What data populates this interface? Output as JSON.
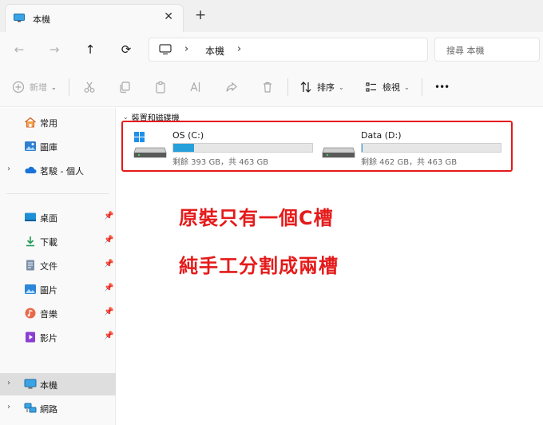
{
  "tab": {
    "label": "本機",
    "close_glyph": "✕",
    "new_tab_glyph": "+"
  },
  "nav": {
    "back_glyph": "←",
    "forward_glyph": "→",
    "up_glyph": "↑",
    "refresh_glyph": "⟳",
    "breadcrumb_sep": "›",
    "breadcrumb_item": "本機",
    "search_placeholder": "搜尋 本機"
  },
  "toolbar": {
    "new_label": "新增",
    "sort_label": "排序",
    "view_label": "檢視",
    "more_glyph": "•••"
  },
  "sidebar": {
    "items": [
      {
        "label": "常用",
        "icon": "home-icon"
      },
      {
        "label": "圖庫",
        "icon": "gallery-icon"
      },
      {
        "label": "茗駿 - 個人",
        "icon": "onedrive-cloud-icon"
      },
      {
        "label": "桌面",
        "icon": "desktop-folder-icon"
      },
      {
        "label": "下載",
        "icon": "download-icon"
      },
      {
        "label": "文件",
        "icon": "documents-icon"
      },
      {
        "label": "圖片",
        "icon": "pictures-icon"
      },
      {
        "label": "音樂",
        "icon": "music-icon"
      },
      {
        "label": "影片",
        "icon": "videos-icon"
      },
      {
        "label": "本機",
        "icon": "this-pc-icon"
      },
      {
        "label": "網路",
        "icon": "network-icon"
      }
    ],
    "pin_glyph": "📌",
    "caret_glyph": "›"
  },
  "main": {
    "group_header": "裝置和磁碟機",
    "drives": [
      {
        "name": "OS (C:)",
        "space": "剩餘 393 GB，共 463 GB",
        "used_fraction": 0.151
      },
      {
        "name": "Data (D:)",
        "space": "剩餘 462 GB，共 463 GB",
        "used_fraction": 0.002
      }
    ]
  },
  "annotations": {
    "line1": "原裝只有一個C槽",
    "line2": "純手工分割成兩槽"
  },
  "colors": {
    "accent": "#26a0da",
    "annotation_red": "#e51a1a"
  }
}
